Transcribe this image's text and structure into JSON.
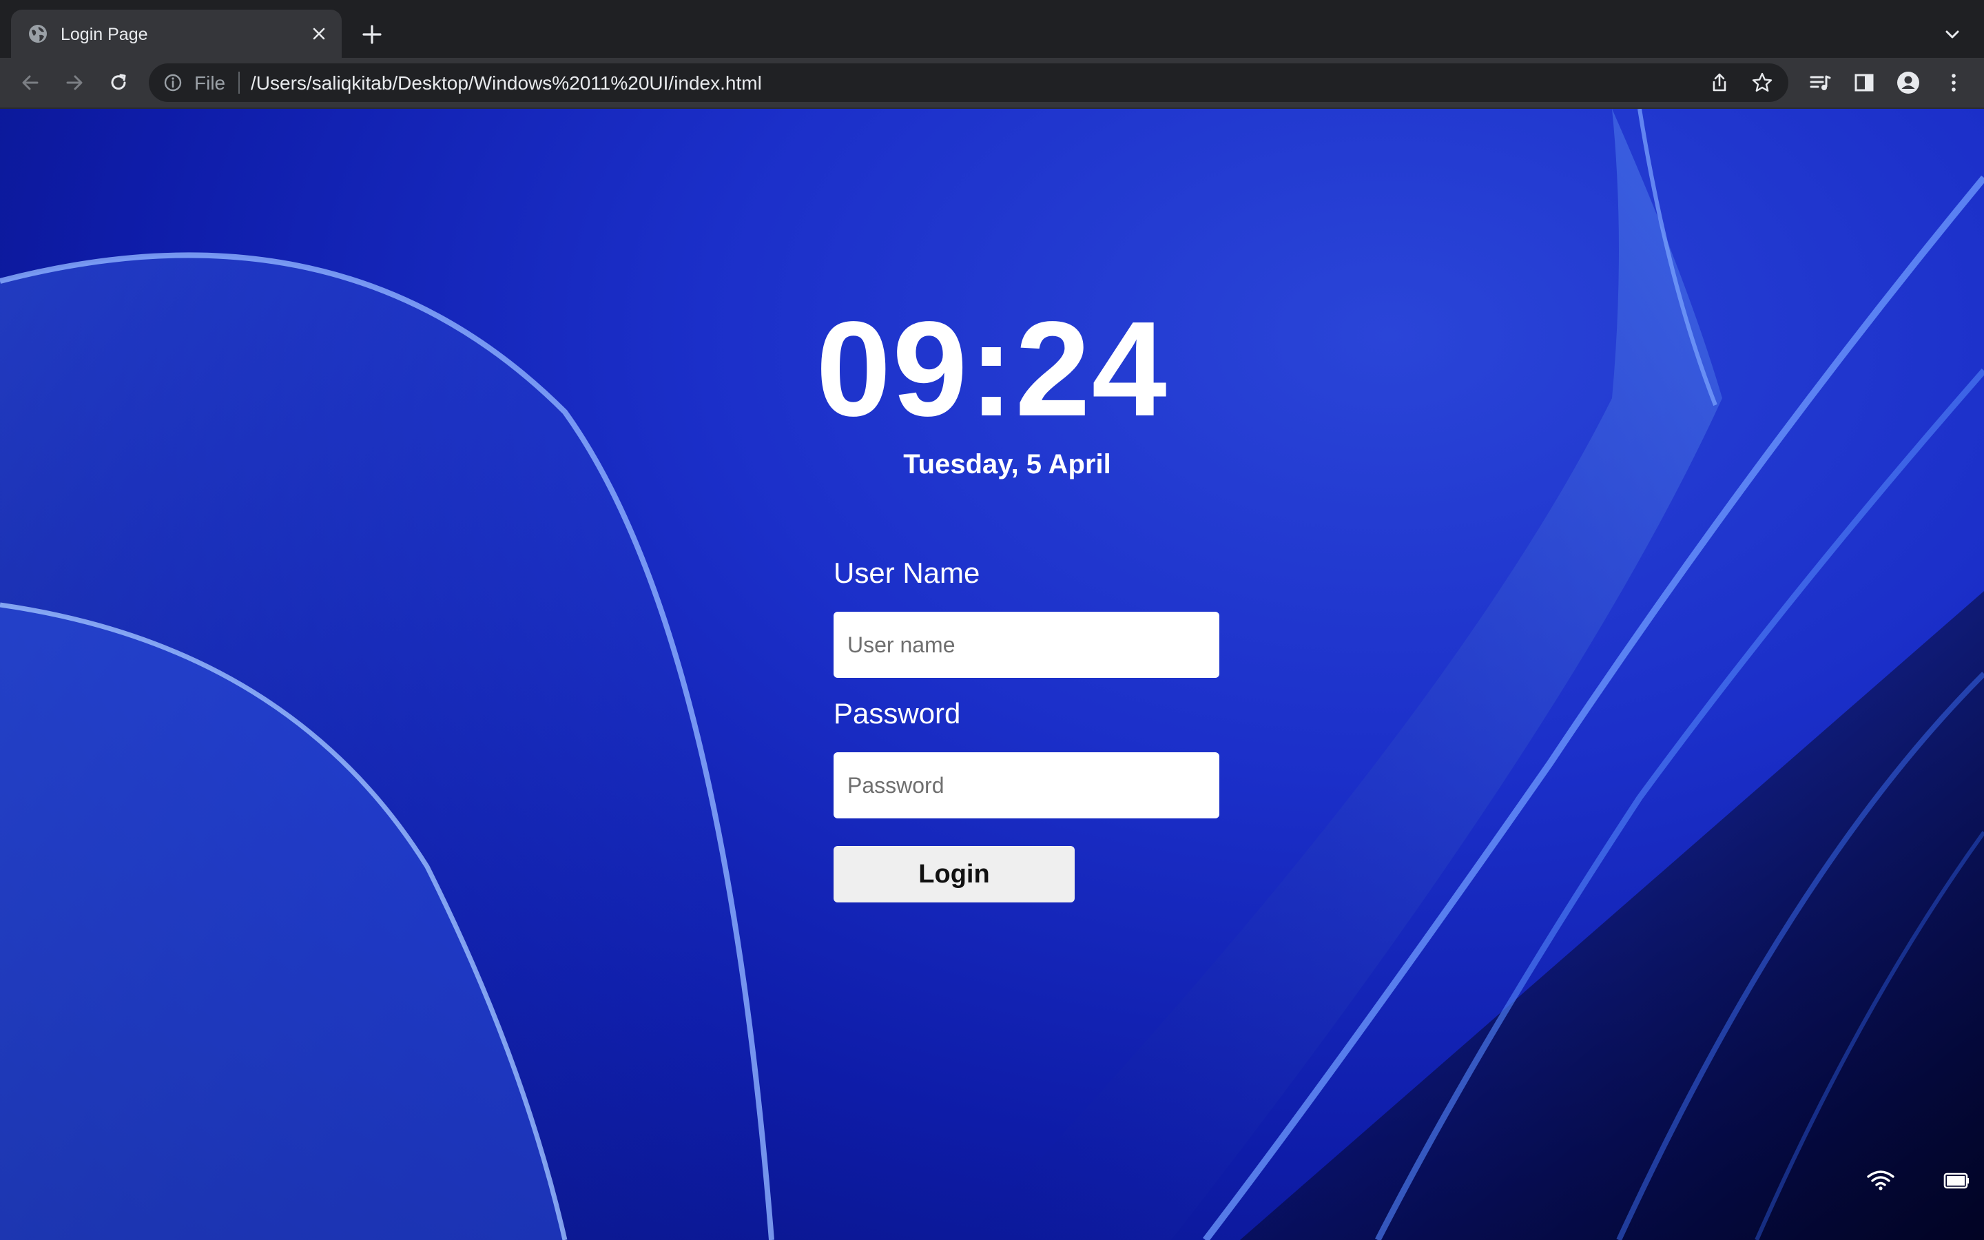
{
  "browser": {
    "tab": {
      "title": "Login Page",
      "favicon": "globe-icon",
      "close_icon": "close-icon"
    },
    "new_tab_icon": "plus-icon",
    "tab_search_icon": "chevron-down-icon",
    "toolbar": {
      "back_icon": "arrow-left-icon",
      "forward_icon": "arrow-right-icon",
      "reload_icon": "reload-icon",
      "omnibox": {
        "info_icon": "info-icon",
        "scheme_label": "File",
        "url": "/Users/saliqkitab/Desktop/Windows%2011%20UI/index.html",
        "share_icon": "share-icon",
        "bookmark_icon": "star-icon"
      },
      "media_icon": "media-queue-icon",
      "sidepanel_icon": "side-panel-icon",
      "profile_icon": "profile-icon",
      "menu_icon": "kebab-menu-icon"
    }
  },
  "page": {
    "clock": "09:24",
    "date": "Tuesday, 5 April",
    "form": {
      "username_label": "User Name",
      "username_placeholder": "User name",
      "username_value": "",
      "password_label": "Password",
      "password_placeholder": "Password",
      "password_value": "",
      "login_button": "Login"
    },
    "status": {
      "wifi_icon": "wifi-icon",
      "battery_icon": "battery-icon"
    }
  },
  "colors": {
    "wallpaper_primary": "#1b2fc9",
    "wallpaper_dark": "#061070",
    "wallpaper_highlight": "#5b8ff0",
    "browser_chrome": "#35363a",
    "tab_strip": "#1f2023"
  }
}
